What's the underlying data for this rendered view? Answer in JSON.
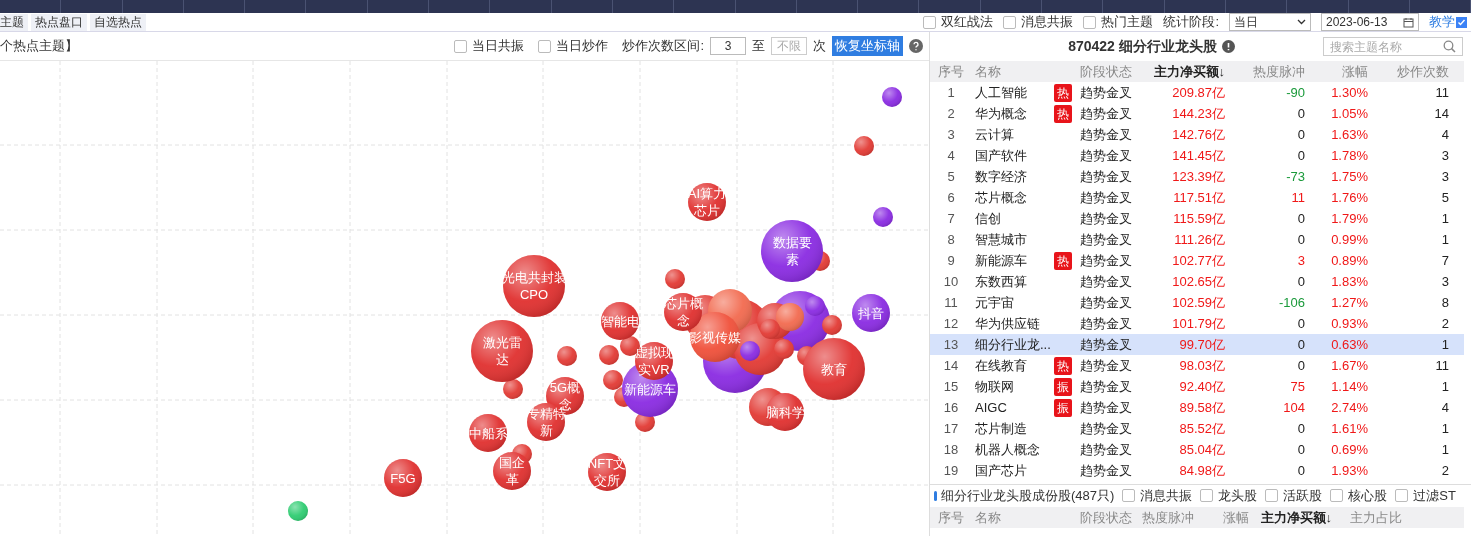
{
  "tabs": [
    {
      "label": "主题",
      "selected": false
    },
    {
      "label": "热点盘口",
      "selected": false
    },
    {
      "label": "自选热点",
      "selected": false
    }
  ],
  "filters": [
    {
      "label": "双红战法",
      "checked": false
    },
    {
      "label": "消息共振",
      "checked": false
    },
    {
      "label": "热门主题",
      "checked": false
    }
  ],
  "period": {
    "label": "统计阶段:",
    "value": "当日"
  },
  "date": "2023-06-13",
  "help_link": {
    "label": "教学",
    "checked": true
  },
  "chart_toolbar": {
    "title": "个热点主题】",
    "options": [
      {
        "label": "当日共振",
        "checked": false
      },
      {
        "label": "当日炒作",
        "checked": false
      }
    ],
    "range_label": "炒作次数区间:",
    "range_from": "3",
    "range_to_label": "至",
    "range_to_placeholder": "不限",
    "unit": "次",
    "reset_button": "恢复坐标轴"
  },
  "bubbles": [
    {
      "lines": [
        "AI算力",
        "芯片"
      ],
      "color": "#e0302f"
    },
    {
      "lines": [
        "数据要",
        "素"
      ],
      "color": "#8a2be2"
    },
    {
      "lines": [
        "光电共封装",
        "CPO"
      ],
      "color": "#e0302f"
    },
    {
      "lines": [
        "智能电"
      ],
      "color": "#e0302f"
    },
    {
      "lines": [
        "芯片概",
        "念"
      ],
      "color": "#e0302f"
    },
    {
      "lines": [
        "抖音"
      ],
      "color": "#8a2be2"
    },
    {
      "lines": [
        "影视传媒"
      ],
      "color": "#f0503a"
    },
    {
      "lines": [
        "激光雷",
        "达"
      ],
      "color": "#e0302f"
    },
    {
      "lines": [
        "虚拟现",
        "实VR"
      ],
      "color": "#e0302f"
    },
    {
      "lines": [
        "教育"
      ],
      "color": "#e0302f"
    },
    {
      "lines": [
        "5G概",
        "念"
      ],
      "color": "#e0302f"
    },
    {
      "lines": [
        "新能源车"
      ],
      "color": "#8a2be2"
    },
    {
      "lines": [
        "中船系"
      ],
      "color": "#e0302f"
    },
    {
      "lines": [
        "专精特",
        "新"
      ],
      "color": "#e0302f"
    },
    {
      "lines": [
        "脑科学"
      ],
      "color": "#e0302f"
    },
    {
      "lines": [
        "F5G"
      ],
      "color": "#e0302f"
    },
    {
      "lines": [
        "国企",
        "革"
      ],
      "color": "#e0302f"
    },
    {
      "lines": [
        "NFT文",
        "交所"
      ],
      "color": "#e0302f"
    }
  ],
  "panel": {
    "title": "870422 细分行业龙头股",
    "search_placeholder": "搜索主题名称",
    "columns": [
      "序号",
      "名称",
      "阶段状态",
      "主力净买额↓",
      "热度脉冲",
      "涨幅",
      "炒作次数"
    ],
    "rows": [
      {
        "seq": "1",
        "name": "人工智能",
        "badge": "热",
        "status": "趋势金叉",
        "net": "209.87亿",
        "heat": {
          "text": "-90",
          "color": "#1a9a3a"
        },
        "pct": "1.30%",
        "count": "11",
        "selected": false
      },
      {
        "seq": "2",
        "name": "华为概念",
        "badge": "热",
        "status": "趋势金叉",
        "net": "144.23亿",
        "heat": {
          "text": "0"
        },
        "pct": "1.05%",
        "count": "14",
        "selected": false
      },
      {
        "seq": "3",
        "name": "云计算",
        "status": "趋势金叉",
        "net": "142.76亿",
        "heat": {
          "text": "0"
        },
        "pct": "1.63%",
        "count": "4",
        "selected": false
      },
      {
        "seq": "4",
        "name": "国产软件",
        "status": "趋势金叉",
        "net": "141.45亿",
        "heat": {
          "text": "0"
        },
        "pct": "1.78%",
        "count": "3",
        "selected": false
      },
      {
        "seq": "5",
        "name": "数字经济",
        "status": "趋势金叉",
        "net": "123.39亿",
        "heat": {
          "text": "-73",
          "color": "#1a9a3a"
        },
        "pct": "1.75%",
        "count": "3",
        "selected": false
      },
      {
        "seq": "6",
        "name": "芯片概念",
        "status": "趋势金叉",
        "net": "117.51亿",
        "heat": {
          "text": "11",
          "color": "#f01818"
        },
        "pct": "1.76%",
        "count": "5",
        "selected": false
      },
      {
        "seq": "7",
        "name": "信创",
        "status": "趋势金叉",
        "net": "115.59亿",
        "heat": {
          "text": "0"
        },
        "pct": "1.79%",
        "count": "1",
        "selected": false
      },
      {
        "seq": "8",
        "name": "智慧城市",
        "status": "趋势金叉",
        "net": "111.26亿",
        "heat": {
          "text": "0"
        },
        "pct": "0.99%",
        "count": "1",
        "selected": false
      },
      {
        "seq": "9",
        "name": "新能源车",
        "badge": "热",
        "status": "趋势金叉",
        "net": "102.77亿",
        "heat": {
          "text": "3",
          "color": "#f01818"
        },
        "pct": "0.89%",
        "count": "7",
        "selected": false
      },
      {
        "seq": "10",
        "name": "东数西算",
        "status": "趋势金叉",
        "net": "102.65亿",
        "heat": {
          "text": "0"
        },
        "pct": "1.83%",
        "count": "3",
        "selected": false
      },
      {
        "seq": "11",
        "name": "元宇宙",
        "status": "趋势金叉",
        "net": "102.59亿",
        "heat": {
          "text": "-106",
          "color": "#1a9a3a"
        },
        "pct": "1.27%",
        "count": "8",
        "selected": false
      },
      {
        "seq": "12",
        "name": "华为供应链",
        "status": "趋势金叉",
        "net": "101.79亿",
        "heat": {
          "text": "0"
        },
        "pct": "0.93%",
        "count": "2",
        "selected": false
      },
      {
        "seq": "13",
        "name": "细分行业龙...",
        "status": "趋势金叉",
        "net": "99.70亿",
        "heat": {
          "text": "0"
        },
        "pct": "0.63%",
        "count": "1",
        "selected": true
      },
      {
        "seq": "14",
        "name": "在线教育",
        "badge": "热",
        "status": "趋势金叉",
        "net": "98.03亿",
        "heat": {
          "text": "0"
        },
        "pct": "1.67%",
        "count": "11",
        "selected": false
      },
      {
        "seq": "15",
        "name": "物联网",
        "badge": "振",
        "status": "趋势金叉",
        "net": "92.40亿",
        "heat": {
          "text": "75",
          "color": "#f01818"
        },
        "pct": "1.14%",
        "count": "1",
        "selected": false
      },
      {
        "seq": "16",
        "name": "AIGC",
        "badge": "振",
        "status": "趋势金叉",
        "net": "89.58亿",
        "heat": {
          "text": "104",
          "color": "#f01818"
        },
        "pct": "2.74%",
        "count": "4",
        "selected": false
      },
      {
        "seq": "17",
        "name": "芯片制造",
        "status": "趋势金叉",
        "net": "85.52亿",
        "heat": {
          "text": "0"
        },
        "pct": "1.61%",
        "count": "1",
        "selected": false
      },
      {
        "seq": "18",
        "name": "机器人概念",
        "status": "趋势金叉",
        "net": "85.04亿",
        "heat": {
          "text": "0"
        },
        "pct": "0.69%",
        "count": "1",
        "selected": false
      },
      {
        "seq": "19",
        "name": "国产芯片",
        "status": "趋势金叉",
        "net": "84.98亿",
        "heat": {
          "text": "0"
        },
        "pct": "1.93%",
        "count": "2",
        "selected": false
      }
    ]
  },
  "stocks": {
    "title": "细分行业龙头股成份股(487只)",
    "filters": [
      {
        "label": "消息共振",
        "checked": false
      },
      {
        "label": "龙头股",
        "checked": false
      },
      {
        "label": "活跃股",
        "checked": false
      },
      {
        "label": "核心股",
        "checked": false
      },
      {
        "label": "过滤ST",
        "checked": false
      }
    ],
    "columns": [
      "序号",
      "名称",
      "阶段状态",
      "热度脉冲",
      "涨幅",
      "主力净买额↓",
      "主力占比"
    ]
  }
}
